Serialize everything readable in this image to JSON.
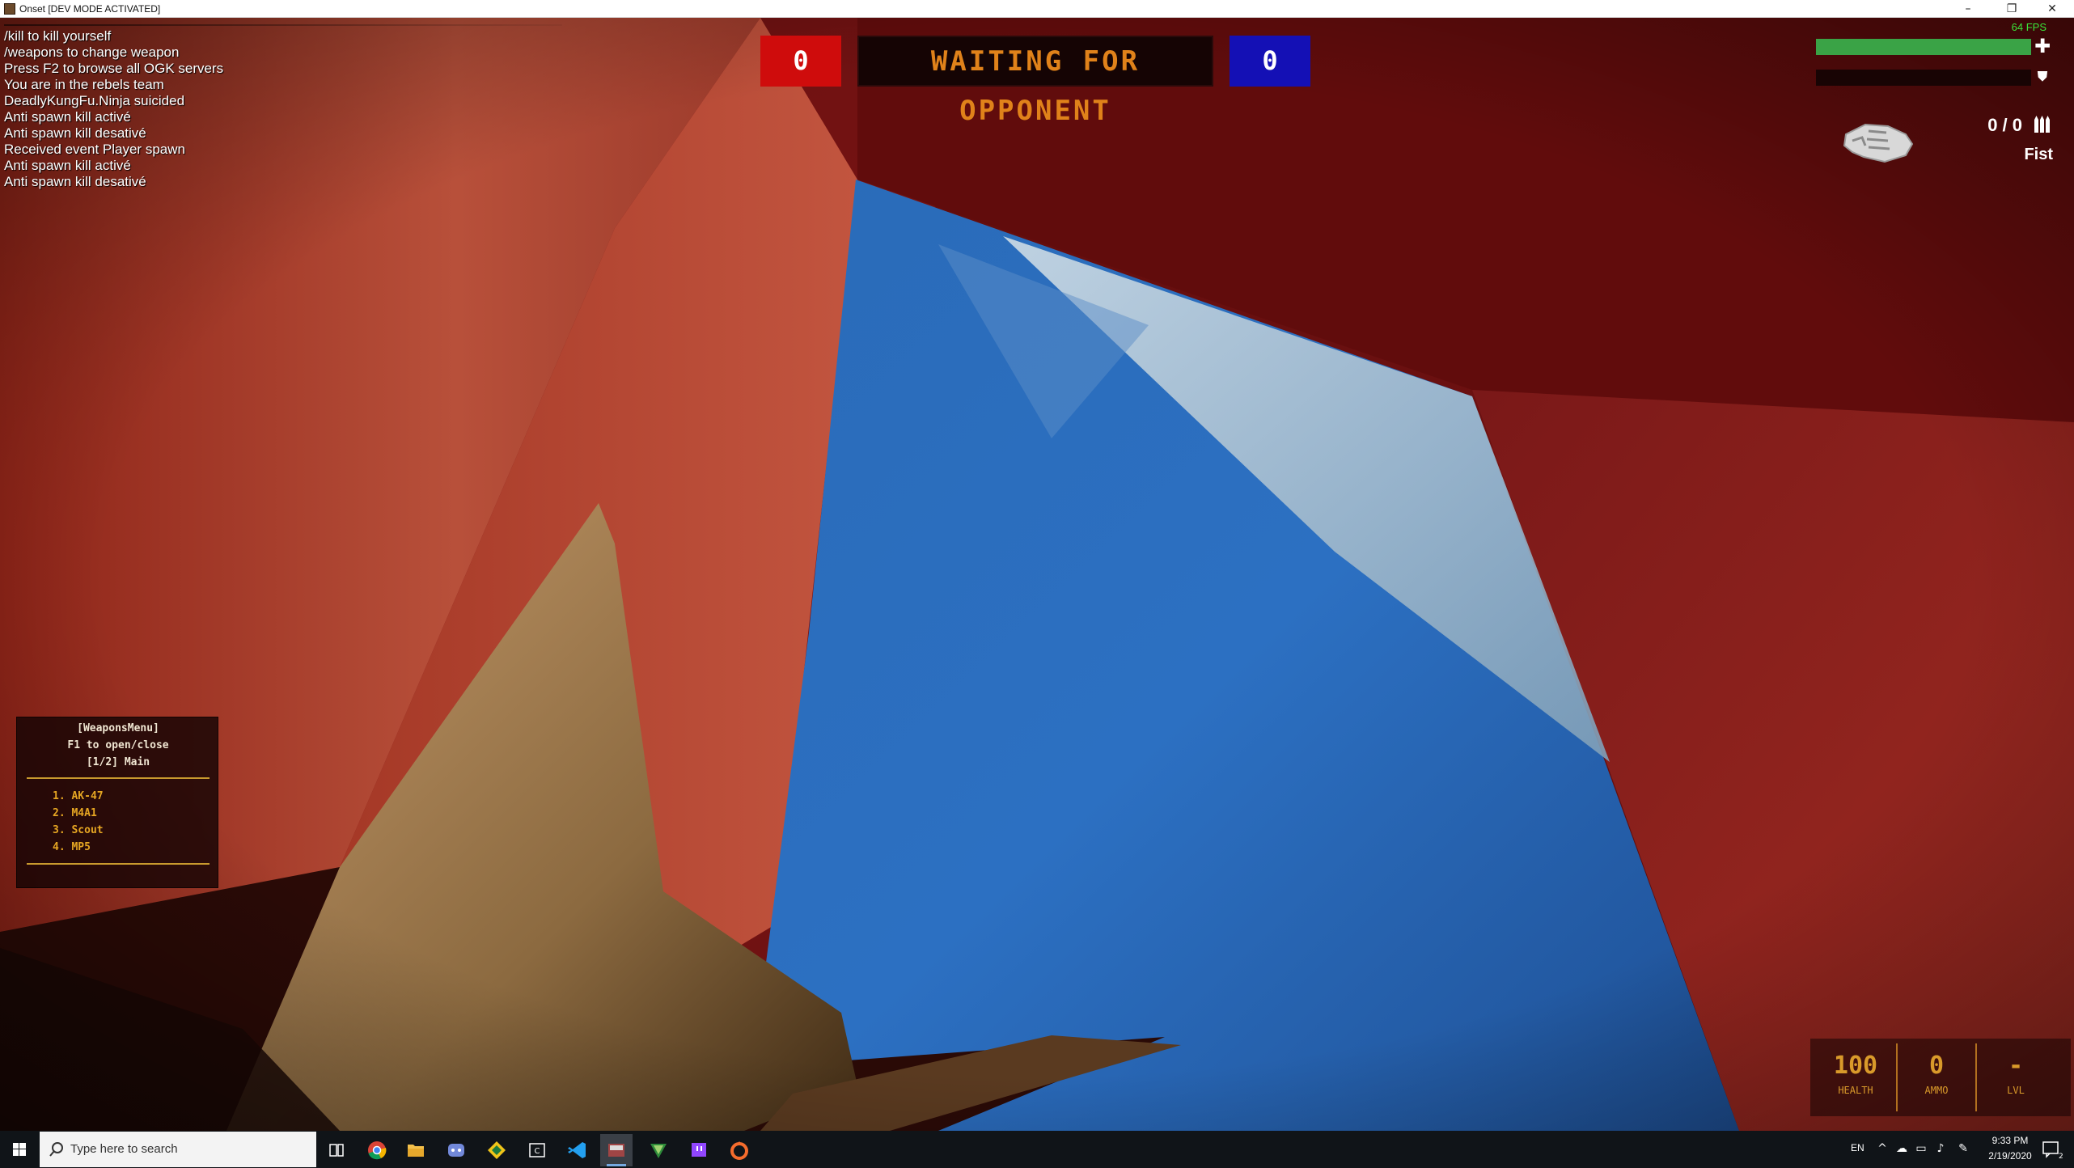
{
  "window": {
    "title": "Onset [DEV MODE ACTIVATED]",
    "controls": [
      "–",
      "❐",
      "✕"
    ]
  },
  "chat": {
    "lines": [
      "/kill to kill yourself",
      "/weapons to change weapon",
      "Press F2 to browse all OGK servers",
      "You are in the rebels team",
      "DeadlyKungFu.Ninja suicided",
      "Anti spawn kill activé",
      "Anti spawn kill desativé",
      "Received event Player spawn",
      "Anti spawn kill activé",
      "Anti spawn kill desativé"
    ]
  },
  "scoreboard": {
    "red_score": "0",
    "status": "WAITING FOR OPPONENT",
    "blue_score": "0",
    "red_color": "#cf0c0c",
    "blue_color": "#1410b5",
    "status_color": "#e0821a"
  },
  "hud": {
    "fps": "64 FPS",
    "health_fraction": 1.0,
    "armor_fraction": 0.0,
    "health_icon": "plus-icon",
    "armor_icon": "shield-icon",
    "health_color": "#3aa346",
    "weapon": {
      "ammo": "0 / 0",
      "name": "Fist",
      "icon": "fist-icon",
      "ammo_icon": "ammo-icon"
    }
  },
  "weapons_menu": {
    "title": "[WeaponsMenu]",
    "hint": "F1 to open/close",
    "page": "[1/2] Main",
    "items": [
      "1. AK-47",
      "2. M4A1",
      "3. Scout",
      "4. MP5"
    ]
  },
  "stats": {
    "health_value": "100",
    "health_label": "HEALTH",
    "ammo_value": "0",
    "ammo_label": "AMMO",
    "level_value": "-",
    "level_label": "LVL",
    "color": "#d99a2a"
  },
  "taskbar": {
    "search_placeholder": "Type here to search",
    "apps": [
      "task-view",
      "chrome",
      "file-explorer",
      "discord",
      "git-client",
      "cpu-monitor",
      "vscode",
      "onset",
      "vim",
      "twitch",
      "origin"
    ],
    "language": "EN",
    "time": "9:33 PM",
    "date": "2/19/2020",
    "notification_count": "2"
  }
}
